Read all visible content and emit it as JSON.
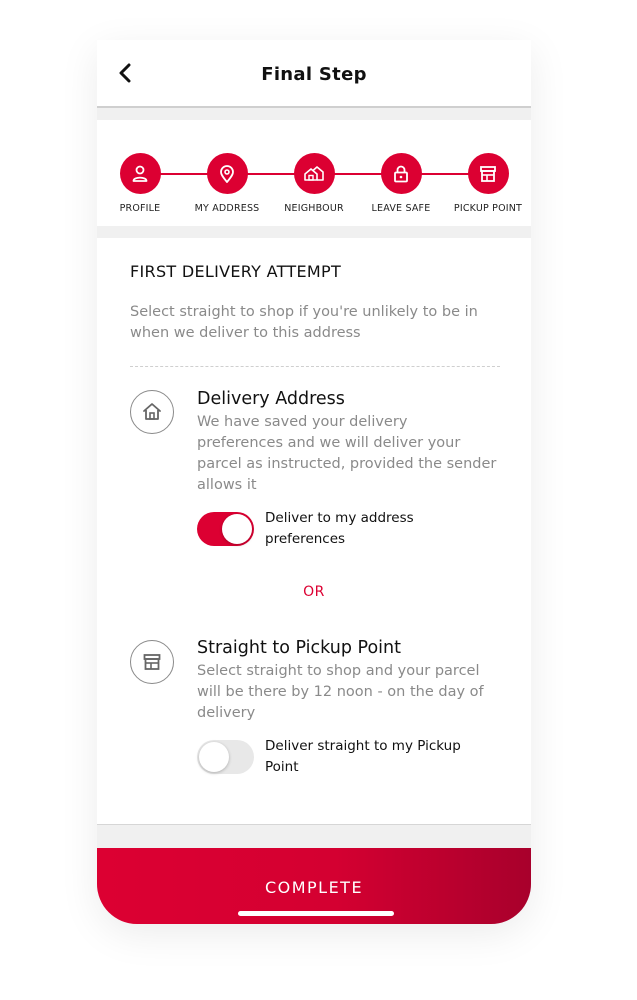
{
  "header": {
    "title": "Final Step",
    "back_icon": "chevron-left-icon"
  },
  "steps": [
    {
      "label": "PROFILE",
      "icon": "user-icon"
    },
    {
      "label": "MY ADDRESS",
      "icon": "map-pin-icon"
    },
    {
      "label": "NEIGHBOUR",
      "icon": "houses-icon"
    },
    {
      "label": "LEAVE SAFE",
      "icon": "lock-icon"
    },
    {
      "label": "PICKUP POINT",
      "icon": "shop-icon"
    }
  ],
  "section": {
    "title": "FIRST DELIVERY ATTEMPT",
    "description": "Select straight to shop if you're unlikely to be in when we deliver to this address"
  },
  "options": [
    {
      "title": "Delivery Address",
      "description": "We have saved your delivery preferences and we will deliver your parcel as instructed, provided the sender allows it",
      "toggle_label": "Deliver to my address preferences",
      "toggle_on": true,
      "icon": "home-icon"
    },
    {
      "title": "Straight to Pickup Point",
      "description": "Select straight to shop and your parcel will be there by 12 noon - on the day of delivery",
      "toggle_label": "Deliver straight to my Pickup Point",
      "toggle_on": false,
      "icon": "shop-icon"
    }
  ],
  "or_label": "OR",
  "complete_label": "COMPLETE",
  "colors": {
    "accent": "#dc0032",
    "muted_text": "#8a8a8a"
  }
}
